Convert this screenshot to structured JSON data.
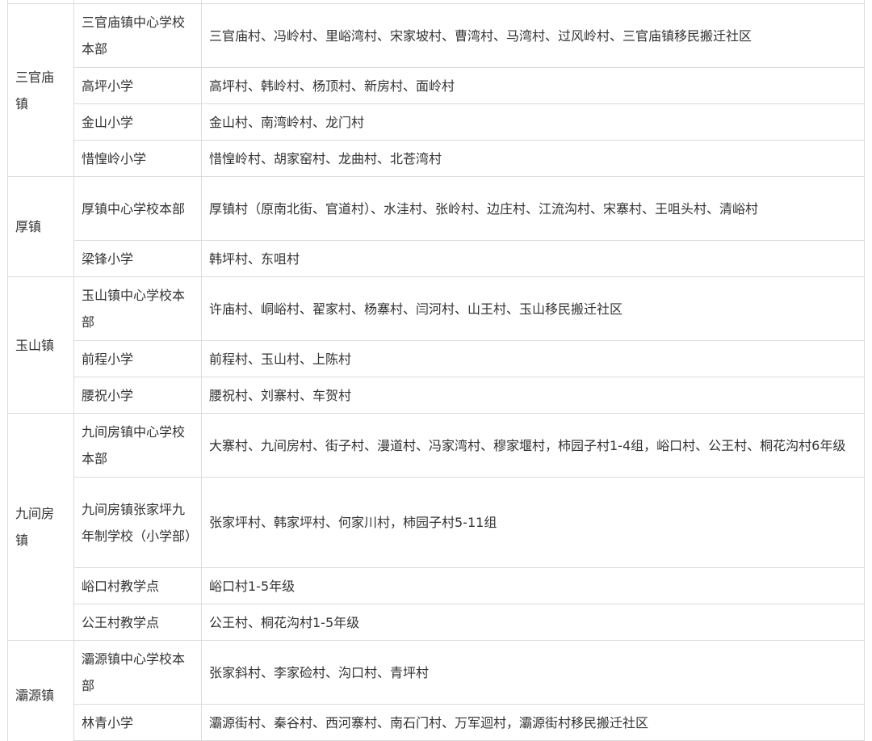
{
  "towns": [
    {
      "name": "三官庙镇",
      "schools": [
        {
          "school": "三官庙镇中心学校本部",
          "villages": "三官庙村、冯岭村、里峪湾村、宋家坡村、曹湾村、马湾村、过风岭村、三官庙镇移民搬迁社区"
        },
        {
          "school": "高坪小学",
          "villages": "高坪村、韩岭村、杨顶村、新房村、面岭村"
        },
        {
          "school": "金山小学",
          "villages": "金山村、南湾岭村、龙门村"
        },
        {
          "school": "惜惶岭小学",
          "villages": "惜惶岭村、胡家窑村、龙曲村、北苍湾村"
        }
      ]
    },
    {
      "name": "厚镇",
      "schools": [
        {
          "school": "厚镇中心学校本部",
          "villages": "厚镇村（原南北街、官道村）、水洼村、张岭村、边庄村、江流沟村、宋寨村、王咀头村、清峪村"
        },
        {
          "school": "梁锋小学",
          "villages": "韩坪村、东咀村"
        }
      ]
    },
    {
      "name": "玉山镇",
      "schools": [
        {
          "school": "玉山镇中心学校本部",
          "villages": "许庙村、峒峪村、翟家村、杨寨村、闫河村、山王村、玉山移民搬迁社区"
        },
        {
          "school": "前程小学",
          "villages": "前程村、玉山村、上陈村"
        },
        {
          "school": "腰祝小学",
          "villages": "腰祝村、刘寨村、车贺村"
        }
      ]
    },
    {
      "name": "九间房镇",
      "schools": [
        {
          "school": "九间房镇中心学校本部",
          "villages": "大寨村、九间房村、街子村、漫道村、冯家湾村、穆家堰村，柿园子村1-4组，峪口村、公王村、桐花沟村6年级"
        },
        {
          "school": "九间房镇张家坪九年制学校（小学部）",
          "villages": "张家坪村、韩家坪村、何家川村，柿园子村5-11组"
        },
        {
          "school": "峪口村教学点",
          "villages": "峪口村1-5年级"
        },
        {
          "school": "公王村教学点",
          "villages": "公王村、桐花沟村1-5年级"
        }
      ]
    },
    {
      "name": "灞源镇",
      "schools": [
        {
          "school": "灞源镇中心学校本部",
          "villages": "张家斜村、李家硷村、沟口村、青坪村"
        },
        {
          "school": "林青小学",
          "villages": "灞源街村、秦谷村、西河寨村、南石门村、万军迴村，灞源街村移民搬迁社区"
        }
      ]
    }
  ]
}
